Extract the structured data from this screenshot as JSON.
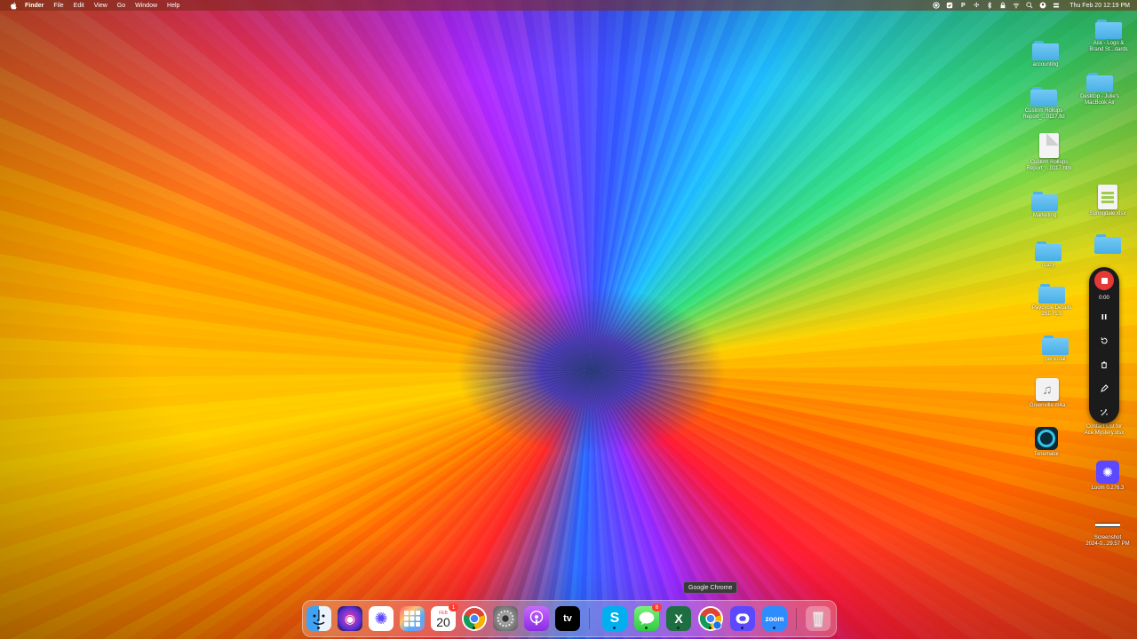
{
  "menubar": {
    "app": "Finder",
    "items": [
      "File",
      "Edit",
      "View",
      "Go",
      "Window",
      "Help"
    ],
    "status_icons": [
      "record-icon",
      "dropbox-icon",
      "p-icon",
      "pinwheel-icon",
      "bluetooth-icon",
      "lock-icon",
      "wifi-icon",
      "search-icon",
      "user-icon",
      "control-center-icon"
    ],
    "clock": "Thu Feb 20  12:19 PM"
  },
  "desktop": {
    "icons": [
      {
        "name": "accounting",
        "type": "folder"
      },
      {
        "name": "Ace - Logo &\nBrand St...dards",
        "type": "folder"
      },
      {
        "name": "Desktop - Julie's\nMacBook Air",
        "type": "folder"
      },
      {
        "name": "Custom Rollups\nReport_...0117.fld",
        "type": "folder"
      },
      {
        "name": "Custom Rollups\nReport_...0117.htm",
        "type": "document"
      },
      {
        "name": "Marketing",
        "type": "folder"
      },
      {
        "name": "Springdale.xlsx",
        "type": "spreadsheet"
      },
      {
        "name": "crazy",
        "type": "folder"
      },
      {
        "name": "Paycycle Details\n251-FLS",
        "type": "folder"
      },
      {
        "name": "personal",
        "type": "folder"
      },
      {
        "name": "Greenville.m4a",
        "type": "audio"
      },
      {
        "name": "Tenemator",
        "type": "app"
      },
      {
        "name": "Contact List for\nAce Mystery.xlsx",
        "type": "spreadsheet"
      },
      {
        "name": "Loom 0.276.3",
        "type": "app"
      },
      {
        "name": "Screenshot\n2024-0...29.57 PM",
        "type": "image"
      }
    ]
  },
  "recorder": {
    "time": "0:00",
    "controls": [
      "stop-icon",
      "pause-icon",
      "restart-icon",
      "trash-icon",
      "pen-icon",
      "effects-icon"
    ]
  },
  "tooltip": "Google Chrome",
  "dock": {
    "apps": [
      {
        "name": "Finder",
        "icon": "finder-icon"
      },
      {
        "name": "Siri",
        "icon": "siri-icon"
      },
      {
        "name": "Perplexity",
        "icon": "perplexity-icon"
      },
      {
        "name": "Launchpad",
        "icon": "launchpad-icon"
      },
      {
        "name": "Calendar",
        "icon": "calendar-icon",
        "month": "FEB",
        "day": "20",
        "badge": "1"
      },
      {
        "name": "Google Chrome",
        "icon": "chrome-icon"
      },
      {
        "name": "System Settings",
        "icon": "settings-icon"
      },
      {
        "name": "Podcasts",
        "icon": "podcasts-icon"
      },
      {
        "name": "Apple TV",
        "icon": "appletv-icon",
        "label": "tv"
      },
      {
        "name": "Skype",
        "icon": "skype-icon",
        "label": "S"
      },
      {
        "name": "Messages",
        "icon": "messages-icon",
        "badge": "6"
      },
      {
        "name": "Microsoft Excel",
        "icon": "excel-icon",
        "label": "X"
      },
      {
        "name": "Google Chrome",
        "icon": "chrome-profile-icon"
      },
      {
        "name": "Loom",
        "icon": "loom-dock-icon"
      },
      {
        "name": "Zoom",
        "icon": "zoom-icon",
        "label": "zoom"
      },
      {
        "name": "Trash",
        "icon": "trash-icon"
      }
    ]
  }
}
